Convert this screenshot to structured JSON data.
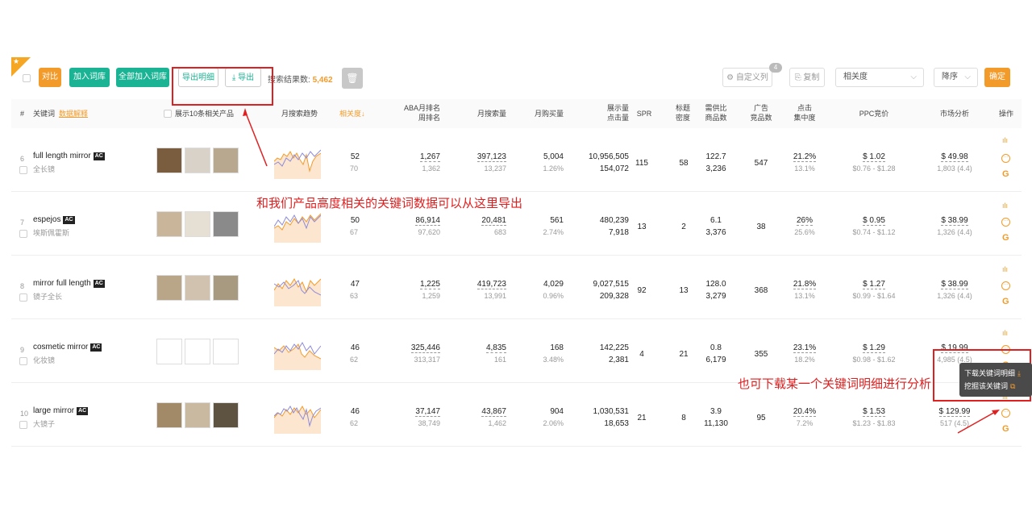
{
  "toolbar": {
    "compare": "对比",
    "add_to_lib": "加入词库",
    "add_all": "全部加入词库",
    "export_detail": "导出明细",
    "export": "导出",
    "result_label": "搜索结果数:",
    "result_count": "5,462",
    "custom_columns": "自定义列",
    "custom_count": "4",
    "copy": "复制",
    "sort_field": "相关度",
    "sort_order": "降序",
    "confirm": "确定"
  },
  "header": {
    "index": "#",
    "keyword": "关键词",
    "data_explain": "数据解释",
    "show_products": "展示10条相关产品",
    "trend": "月搜索趋势",
    "relevance": "相关度↓",
    "aba_rank_1": "ABA月排名",
    "aba_rank_2": "周排名",
    "monthly_search": "月搜索量",
    "monthly_purchase": "月购买量",
    "impressions_1": "展示量",
    "impressions_2": "点击量",
    "spr": "SPR",
    "title_density_1": "标题",
    "title_density_2": "密度",
    "supply_demand_1": "需供比",
    "supply_demand_2": "商品数",
    "ad_1": "广告",
    "ad_2": "竞品数",
    "click_1": "点击",
    "click_2": "集中度",
    "ppc": "PPC竞价",
    "market": "市场分析",
    "actions": "操作"
  },
  "rows": [
    {
      "idx": "6",
      "kw": "full length mirror",
      "cn": "全长镜",
      "rel": "52",
      "rel2": "70",
      "aba": "1,267",
      "aba2": "1,362",
      "search": "397,123",
      "search2": "13,237",
      "purchase": "5,004",
      "purchase2": "1.26%",
      "imp": "10,956,505",
      "imp2": "154,072",
      "spr": "115",
      "title": "58",
      "sd": "122.7",
      "sd2": "3,236",
      "ad": "547",
      "click": "21.2%",
      "click2": "13.1%",
      "ppc": "$ 1.02",
      "ppc2": "$0.76 - $1.28",
      "market": "$ 49.98",
      "market2": "1,803 (4.4)"
    },
    {
      "idx": "7",
      "kw": "espejos",
      "cn": "埃斯佩霍斯",
      "rel": "50",
      "rel2": "67",
      "aba": "86,914",
      "aba2": "97,620",
      "search": "20,481",
      "search2": "683",
      "purchase": "561",
      "purchase2": "2.74%",
      "imp": "480,239",
      "imp2": "7,918",
      "spr": "13",
      "title": "2",
      "sd": "6.1",
      "sd2": "3,376",
      "ad": "38",
      "click": "26%",
      "click2": "25.6%",
      "ppc": "$ 0.95",
      "ppc2": "$0.74 - $1.12",
      "market": "$ 38.99",
      "market2": "1,326 (4.4)"
    },
    {
      "idx": "8",
      "kw": "mirror full length",
      "cn": "镜子全长",
      "rel": "47",
      "rel2": "63",
      "aba": "1,225",
      "aba2": "1,259",
      "search": "419,723",
      "search2": "13,991",
      "purchase": "4,029",
      "purchase2": "0.96%",
      "imp": "9,027,515",
      "imp2": "209,328",
      "spr": "92",
      "title": "13",
      "sd": "128.0",
      "sd2": "3,279",
      "ad": "368",
      "click": "21.8%",
      "click2": "13.1%",
      "ppc": "$ 1.27",
      "ppc2": "$0.99 - $1.64",
      "market": "$ 38.99",
      "market2": "1,326 (4.4)"
    },
    {
      "idx": "9",
      "kw": "cosmetic mirror",
      "cn": "化妆镜",
      "rel": "46",
      "rel2": "62",
      "aba": "325,446",
      "aba2": "313,317",
      "search": "4,835",
      "search2": "161",
      "purchase": "168",
      "purchase2": "3.48%",
      "imp": "142,225",
      "imp2": "2,381",
      "spr": "4",
      "title": "21",
      "sd": "0.8",
      "sd2": "6,179",
      "ad": "355",
      "click": "23.1%",
      "click2": "18.2%",
      "ppc": "$ 1.29",
      "ppc2": "$0.98 - $1.62",
      "market": "$ 19.99",
      "market2": "4,985 (4.5)"
    },
    {
      "idx": "10",
      "kw": "large mirror",
      "cn": "大镜子",
      "rel": "46",
      "rel2": "62",
      "aba": "37,147",
      "aba2": "38,749",
      "search": "43,867",
      "search2": "1,462",
      "purchase": "904",
      "purchase2": "2.06%",
      "imp": "1,030,531",
      "imp2": "18,653",
      "spr": "21",
      "title": "8",
      "sd": "3.9",
      "sd2": "11,130",
      "ad": "95",
      "click": "20.4%",
      "click2": "7.2%",
      "ppc": "$ 1.53",
      "ppc2": "$1.23 - $1.83",
      "market": "$ 129.99",
      "market2": "517 (4.5)"
    }
  ],
  "annotations": {
    "export_note": "和我们产品高度相关的关键词数据可以从这里导出",
    "download_note": "也可下载某一个关键词明细进行分析"
  },
  "tooltip": {
    "download_detail": "下载关键词明细",
    "dig_keyword": "挖掘该关键词"
  },
  "colors": {
    "accent": "#f39b2a",
    "teal": "#1ab394",
    "annotation": "#e02020"
  }
}
